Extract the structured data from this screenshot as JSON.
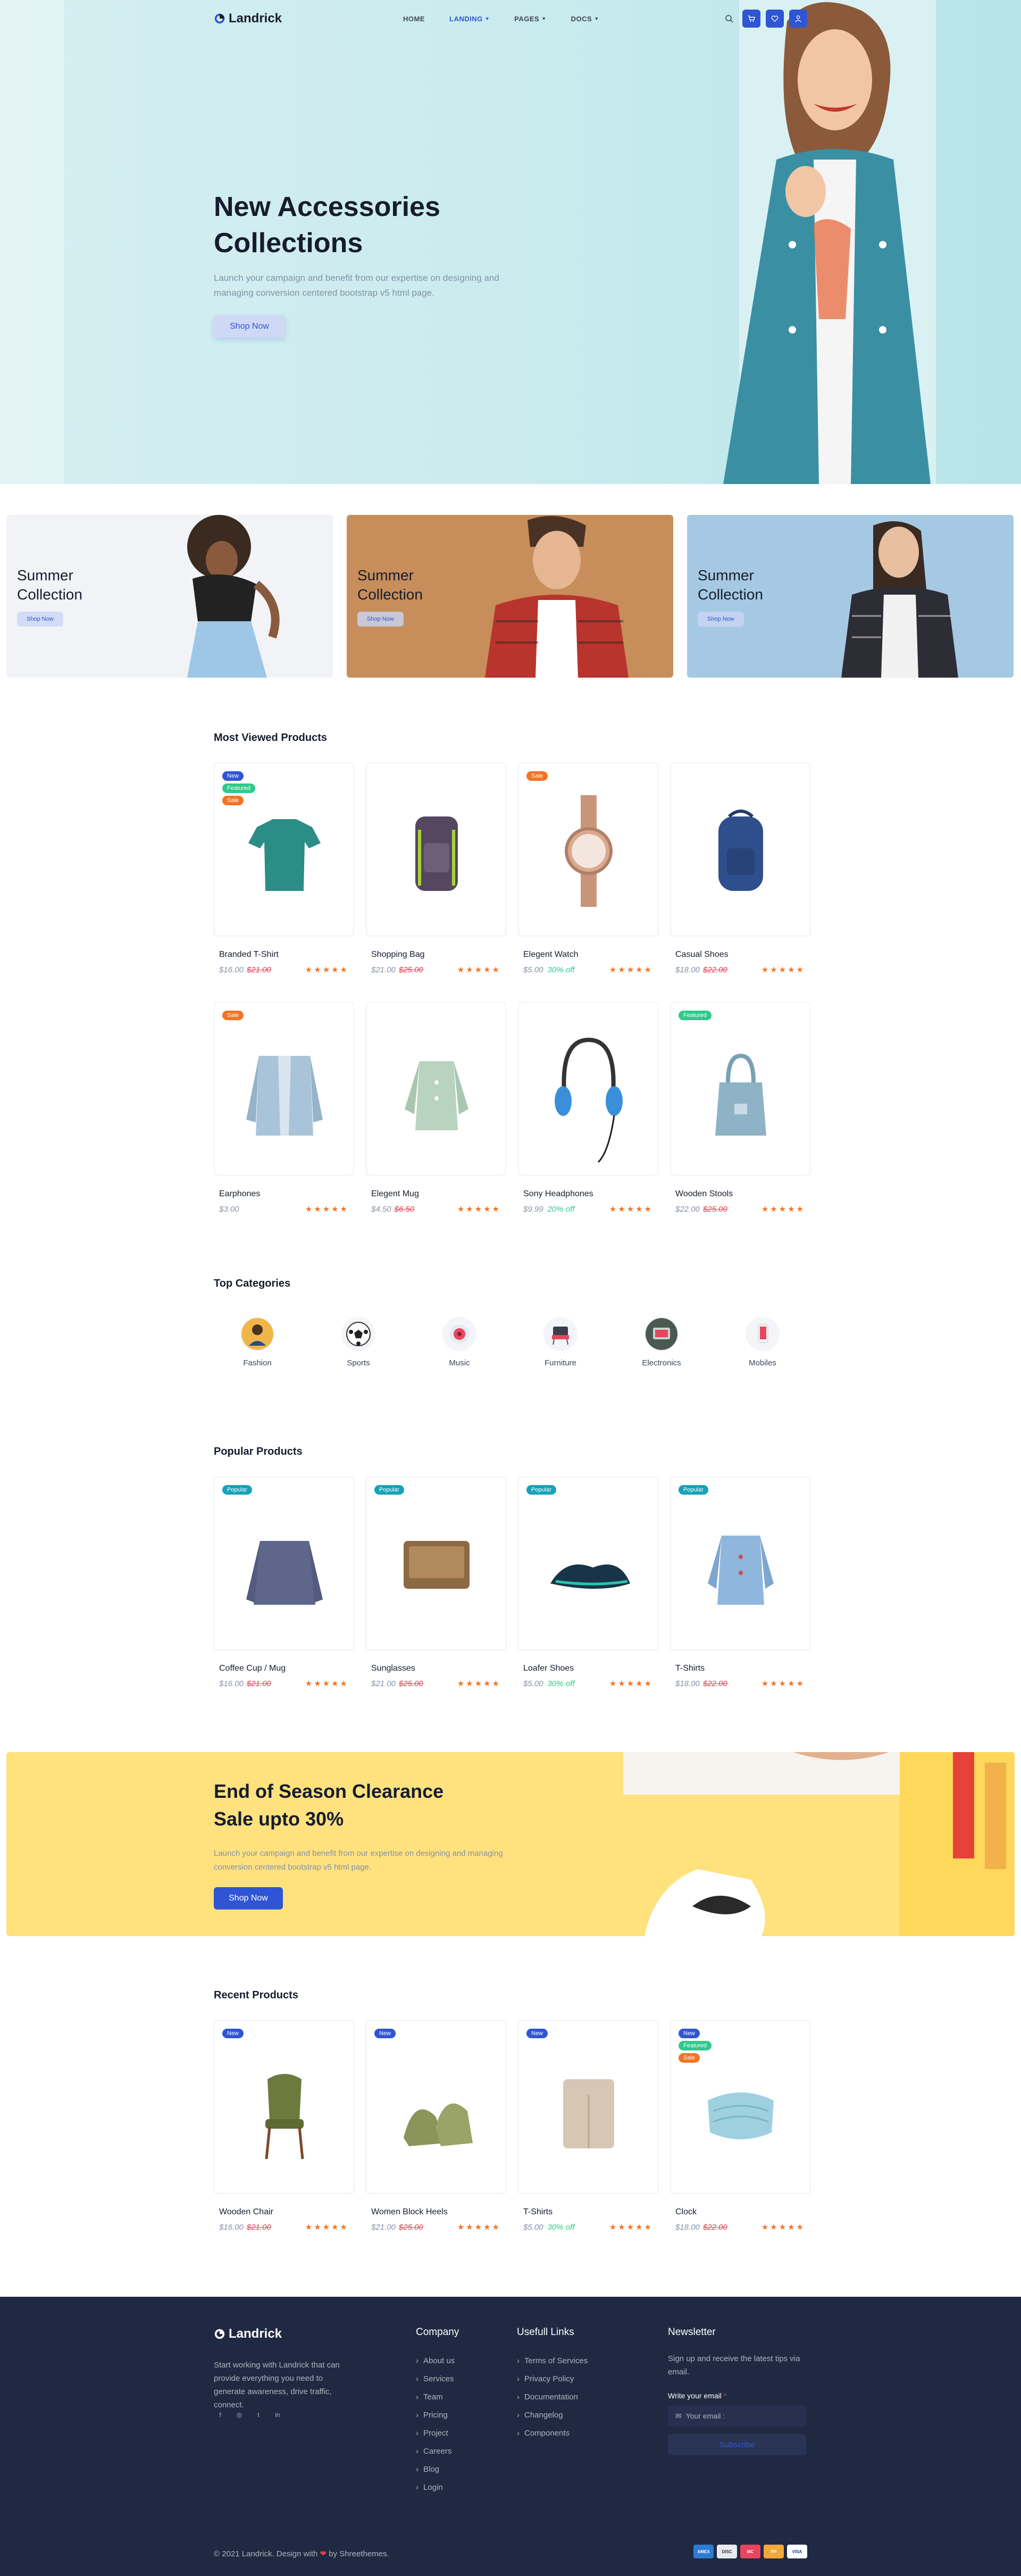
{
  "nav": {
    "logo": "Landrick",
    "menu": [
      "HOME",
      "LANDING",
      "PAGES",
      "DOCS"
    ],
    "active_index": 1,
    "accent": "#2f55d4"
  },
  "hero": {
    "title_line1": "New Accessories",
    "title_line2": "Collections",
    "subtitle": "Launch your campaign and benefit from our expertise on designing and managing conversion centered bootstrap v5 html page.",
    "button": "Shop Now"
  },
  "collections": [
    {
      "line1": "Summer",
      "line2": "Collection",
      "button": "Shop Now",
      "bg": "#f1f3f7"
    },
    {
      "line1": "Summer",
      "line2": "Collection",
      "button": "Shop Now",
      "bg": "#c78d5a"
    },
    {
      "line1": "Summer",
      "line2": "Collection",
      "button": "Shop Now",
      "bg": "#a5c9e2"
    }
  ],
  "most_viewed": {
    "title": "Most Viewed Products",
    "products": [
      {
        "name": "Branded T-Shirt",
        "price": "$16.00",
        "old": "$21.00",
        "off": "",
        "badges": [
          "New",
          "Featured",
          "Sale"
        ]
      },
      {
        "name": "Shopping Bag",
        "price": "$21.00",
        "old": "$25.00",
        "off": "",
        "badges": []
      },
      {
        "name": "Elegent Watch",
        "price": "$5.00",
        "old": "",
        "off": "30% off",
        "badges": [
          "Sale"
        ]
      },
      {
        "name": "Casual Shoes",
        "price": "$18.00",
        "old": "$22.00",
        "off": "",
        "badges": []
      },
      {
        "name": "Earphones",
        "price": "$3.00",
        "old": "",
        "off": "",
        "badges": [
          "Sale"
        ]
      },
      {
        "name": "Elegent Mug",
        "price": "$4.50",
        "old": "$6.50",
        "off": "",
        "badges": []
      },
      {
        "name": "Sony Headphones",
        "price": "$9.99",
        "old": "",
        "off": "20% off",
        "badges": []
      },
      {
        "name": "Wooden Stools",
        "price": "$22.00",
        "old": "$25.00",
        "off": "",
        "badges": [
          "Featured"
        ]
      }
    ]
  },
  "categories": {
    "title": "Top Categories",
    "items": [
      "Fashion",
      "Sports",
      "Music",
      "Furniture",
      "Electronics",
      "Mobiles"
    ]
  },
  "popular": {
    "title": "Popular Products",
    "products": [
      {
        "name": "Coffee Cup / Mug",
        "price": "$16.00",
        "old": "$21.00",
        "off": "",
        "badges": [
          "Popular"
        ]
      },
      {
        "name": "Sunglasses",
        "price": "$21.00",
        "old": "$25.00",
        "off": "",
        "badges": [
          "Popular"
        ]
      },
      {
        "name": "Loafer Shoes",
        "price": "$5.00",
        "old": "",
        "off": "30% off",
        "badges": [
          "Popular"
        ]
      },
      {
        "name": "T-Shirts",
        "price": "$18.00",
        "old": "$22.00",
        "off": "",
        "badges": [
          "Popular"
        ]
      }
    ]
  },
  "banner": {
    "title_line1": "End of Season Clearance",
    "title_line2": "Sale upto 30%",
    "subtitle": "Launch your campaign and benefit from our expertise on designing and managing conversion centered bootstrap v5 html page.",
    "button": "Shop Now"
  },
  "recent": {
    "title": "Recent Products",
    "products": [
      {
        "name": "Wooden Chair",
        "price": "$16.00",
        "old": "$21.00",
        "off": "",
        "badges": [
          "New"
        ]
      },
      {
        "name": "Women Block Heels",
        "price": "$21.00",
        "old": "$25.00",
        "off": "",
        "badges": [
          "New"
        ]
      },
      {
        "name": "T-Shirts",
        "price": "$5.00",
        "old": "",
        "off": "30% off",
        "badges": [
          "New"
        ]
      },
      {
        "name": "Clock",
        "price": "$18.00",
        "old": "$22.00",
        "off": "",
        "badges": [
          "New",
          "Featured",
          "Sale"
        ]
      }
    ]
  },
  "rating_stars": "★★★★★",
  "footer": {
    "logo": "Landrick",
    "description": "Start working with Landrick that can provide everything you need to generate awareness, drive traffic, connect.",
    "company_title": "Company",
    "company_links": [
      "About us",
      "Services",
      "Team",
      "Pricing",
      "Project",
      "Careers",
      "Blog",
      "Login"
    ],
    "useful_title": "Usefull Links",
    "useful_links": [
      "Terms of Services",
      "Privacy Policy",
      "Documentation",
      "Changelog",
      "Components"
    ],
    "newsletter_title": "Newsletter",
    "newsletter_text": "Sign up and receive the latest tips via email.",
    "email_label": "Write your email",
    "email_required": "*",
    "email_placeholder": "Your email :",
    "subscribe": "Subscribe",
    "copyright": "© 2021 Landrick. Design with",
    "copyright_by": "by Shreethemes.",
    "payments": [
      "AMEX",
      "DISC",
      "MC",
      "PP",
      "VISA"
    ]
  }
}
